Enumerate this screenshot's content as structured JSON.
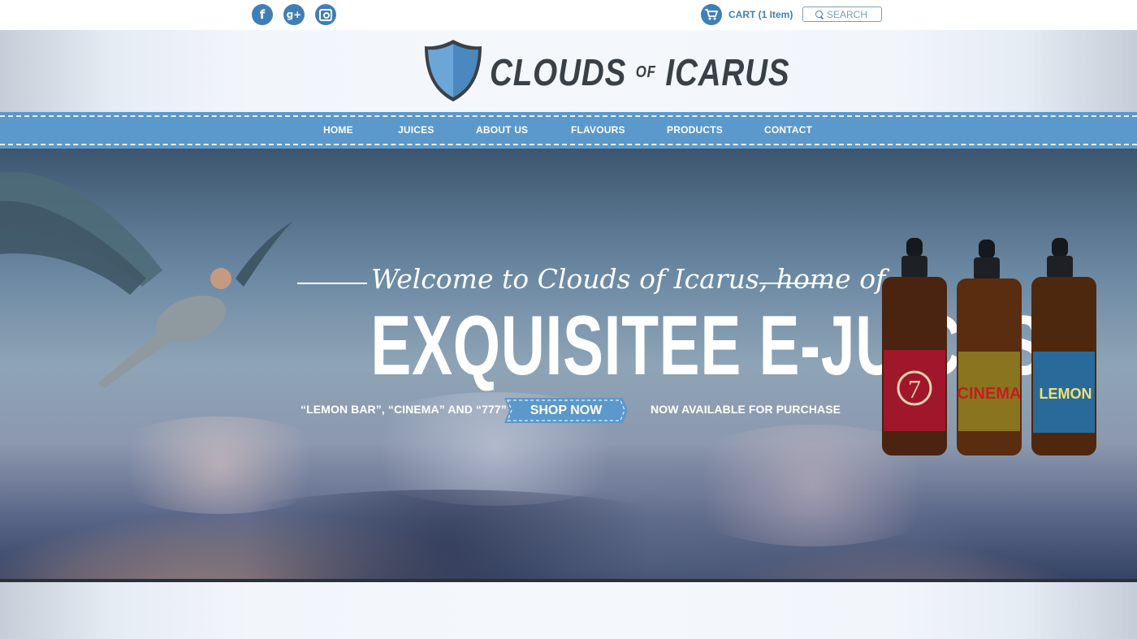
{
  "topbar": {
    "social": [
      {
        "name": "facebook-icon",
        "glyph": "f"
      },
      {
        "name": "google-plus-icon",
        "glyph": "g+"
      },
      {
        "name": "instagram-icon",
        "glyph": ""
      }
    ],
    "cart": {
      "label": "CART",
      "count": "(1 Item)"
    },
    "search": {
      "placeholder": "SEARCH"
    }
  },
  "brand": {
    "name_part1": "CLOUDS",
    "name_of": "OF",
    "name_part2": "ICARUS"
  },
  "nav": {
    "items": [
      "HOME",
      "JUICES",
      "ABOUT US",
      "FLAVOURS",
      "PRODUCTS",
      "CONTACT"
    ]
  },
  "hero": {
    "welcome": "Welcome to Clouds of Icarus, home of",
    "headline": "EXQUISITEE E-JUICES!",
    "flavors_text": "“LEMON BAR”, “CINEMA” AND “777”",
    "shop_button": "SHOP NOW",
    "availability": "NOW AVAILABLE FOR PURCHASE"
  },
  "colors": {
    "brand_blue": "#5b98cb",
    "icon_blue": "#3f7fb6",
    "logo_dark": "#3a4048"
  }
}
